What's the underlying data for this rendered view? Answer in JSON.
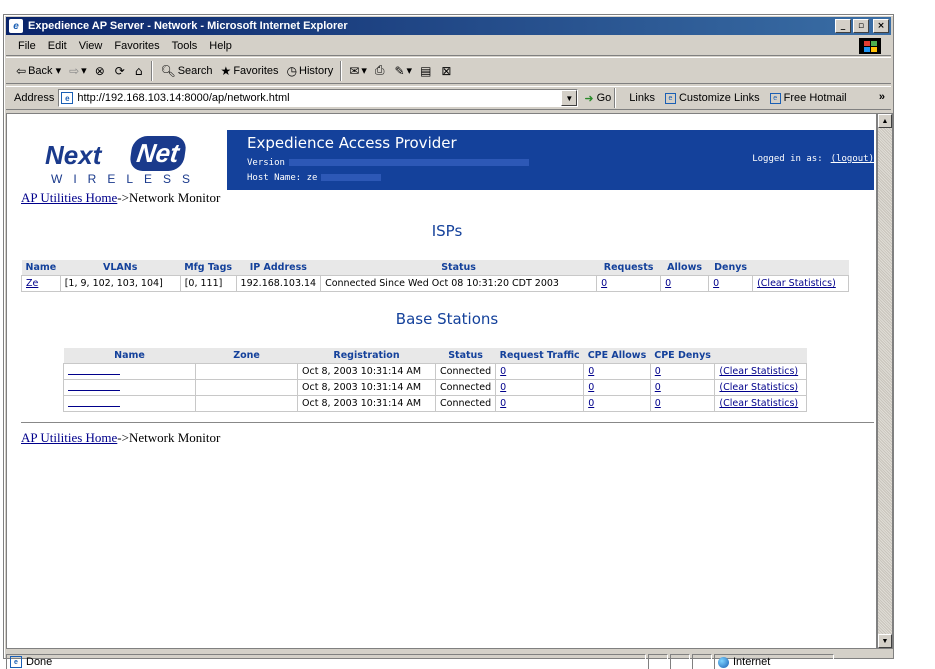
{
  "window": {
    "title": "Expedience AP Server - Network - Microsoft Internet Explorer"
  },
  "menu": [
    "File",
    "Edit",
    "View",
    "Favorites",
    "Tools",
    "Help"
  ],
  "toolbar": {
    "back": "Back",
    "search": "Search",
    "favorites": "Favorites",
    "history": "History"
  },
  "address": {
    "label": "Address",
    "url": "http://192.168.103.14:8000/ap/network.html",
    "go": "Go",
    "links_label": "Links",
    "links": [
      "Customize Links",
      "Free Hotmail"
    ]
  },
  "header": {
    "logo_next": "Next",
    "logo_net": "Net",
    "logo_wireless": "WIRELESS",
    "title": "Expedience Access Provider",
    "version_label": "Version",
    "host_label": "Host Name: ze",
    "logged_in_label": "Logged in as:",
    "logout": "(logout)"
  },
  "breadcrumb": {
    "home": "AP Utilities Home",
    "rest": "->Network Monitor"
  },
  "isps": {
    "title": "ISPs",
    "columns": [
      "Name",
      "VLANs",
      "Mfg Tags",
      "IP Address",
      "Status",
      "Requests",
      "Allows",
      "Denys",
      ""
    ],
    "rows": [
      {
        "name": "Ze",
        "vlans": "[1, 9, 102, 103, 104]",
        "mfg_tags": "[0, 111]",
        "ip": "192.168.103.14",
        "status": "Connected Since Wed Oct 08 10:31:20 CDT 2003",
        "requests": "0",
        "allows": "0",
        "denys": "0",
        "action": "(Clear Statistics)"
      }
    ]
  },
  "base_stations": {
    "title": "Base Stations",
    "columns": [
      "Name",
      "Zone",
      "Registration",
      "Status",
      "Request Traffic",
      "CPE Allows",
      "CPE Denys",
      ""
    ],
    "rows": [
      {
        "name": "",
        "zone": "",
        "registration": "Oct 8, 2003 10:31:14 AM",
        "status": "Connected",
        "request_traffic": "0",
        "cpe_allows": "0",
        "cpe_denys": "0",
        "action": "(Clear Statistics)"
      },
      {
        "name": "",
        "zone": "",
        "registration": "Oct 8, 2003 10:31:14 AM",
        "status": "Connected",
        "request_traffic": "0",
        "cpe_allows": "0",
        "cpe_denys": "0",
        "action": "(Clear Statistics)"
      },
      {
        "name": "",
        "zone": "",
        "registration": "Oct 8, 2003 10:31:14 AM",
        "status": "Connected",
        "request_traffic": "0",
        "cpe_allows": "0",
        "cpe_denys": "0",
        "action": "(Clear Statistics)"
      }
    ]
  },
  "status": {
    "text": "Done",
    "zone": "Internet"
  },
  "colors": {
    "banner": "#14419b",
    "link": "#00008b",
    "title_bar": "#0a246a"
  }
}
